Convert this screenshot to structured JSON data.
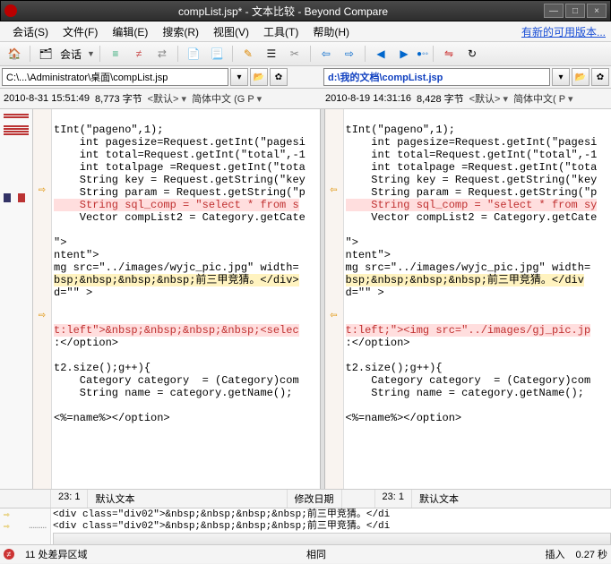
{
  "title": "compList.jsp* - 文本比较 - Beyond Compare",
  "menu": {
    "session": "会话(S)",
    "file": "文件(F)",
    "edit": "编辑(E)",
    "search": "搜索(R)",
    "view": "视图(V)",
    "tools": "工具(T)",
    "help": "帮助(H)",
    "update_link": "有新的可用版本..."
  },
  "toolbar": {
    "session_label": "会话"
  },
  "paths": {
    "left": "C:\\...\\Administrator\\桌面\\compList.jsp",
    "right": "d:\\我的文档\\compList.jsp"
  },
  "info": {
    "left_time": "2010-8-31 15:51:49",
    "left_size": "8,773 字节",
    "left_enc1": "<默认>",
    "left_enc2": "简体中文 (G P",
    "right_time": "2010-8-19 14:31:16",
    "right_size": "8,428 字节",
    "right_enc1": "<默认>",
    "right_enc2": "简体中文( P"
  },
  "code": {
    "l1": "tInt(\"pageno\",1);",
    "l2": "    int pagesize=Request.getInt(\"pagesi",
    "l3": "    int total=Request.getInt(\"total\",-1",
    "l4": "    int totalpage =Request.getInt(\"tota",
    "l5": "    String key = Request.getString(\"key",
    "l6": "    String param = Request.getString(\"p",
    "l7_left": "    String sql_comp = \"select * from s",
    "l7_right": "    String sql_comp = \"select * from sy",
    "l8": "    Vector compList2 = Category.getCate",
    "blank": "",
    "l9": "\">",
    "l10": "ntent\">",
    "l11": "mg src=\"../images/wyjc_pic.jpg\" width=",
    "l12_left": "bsp;&nbsp;&nbsp;&nbsp;前三甲竞猜。</div>",
    "l12_right": "bsp;&nbsp;&nbsp;&nbsp;前三甲竞猜。</div",
    "l13": "d=\"\" >",
    "l14_left": "t:left\">&nbsp;&nbsp;&nbsp;&nbsp;<selec",
    "l14_right": "t:left;\"><img src=\"../images/gj_pic.jp",
    "l15": ":</option>",
    "l16": "t2.size();g++){",
    "l17": "    Category category  = (Category)com",
    "l18": "    String name = category.getName();",
    "l19": "<%=name%></option>"
  },
  "status_cols": {
    "left_pos": "23: 1",
    "left_mode": "默认文本",
    "left_mod": "修改日期",
    "right_pos": "23: 1",
    "right_mode": "默认文本"
  },
  "bottom_code": {
    "line1": "<div class=\"div02\">&nbsp;&nbsp;&nbsp;&nbsp;前三甲竞猜。</di",
    "line2": "<div class=\"div02\">&nbsp;&nbsp;&nbsp;&nbsp;前三甲竞猜。</di"
  },
  "status_bar": {
    "diffs": "11 处差异区域",
    "same": "相同",
    "mode": "插入",
    "time": "0.27 秒"
  }
}
